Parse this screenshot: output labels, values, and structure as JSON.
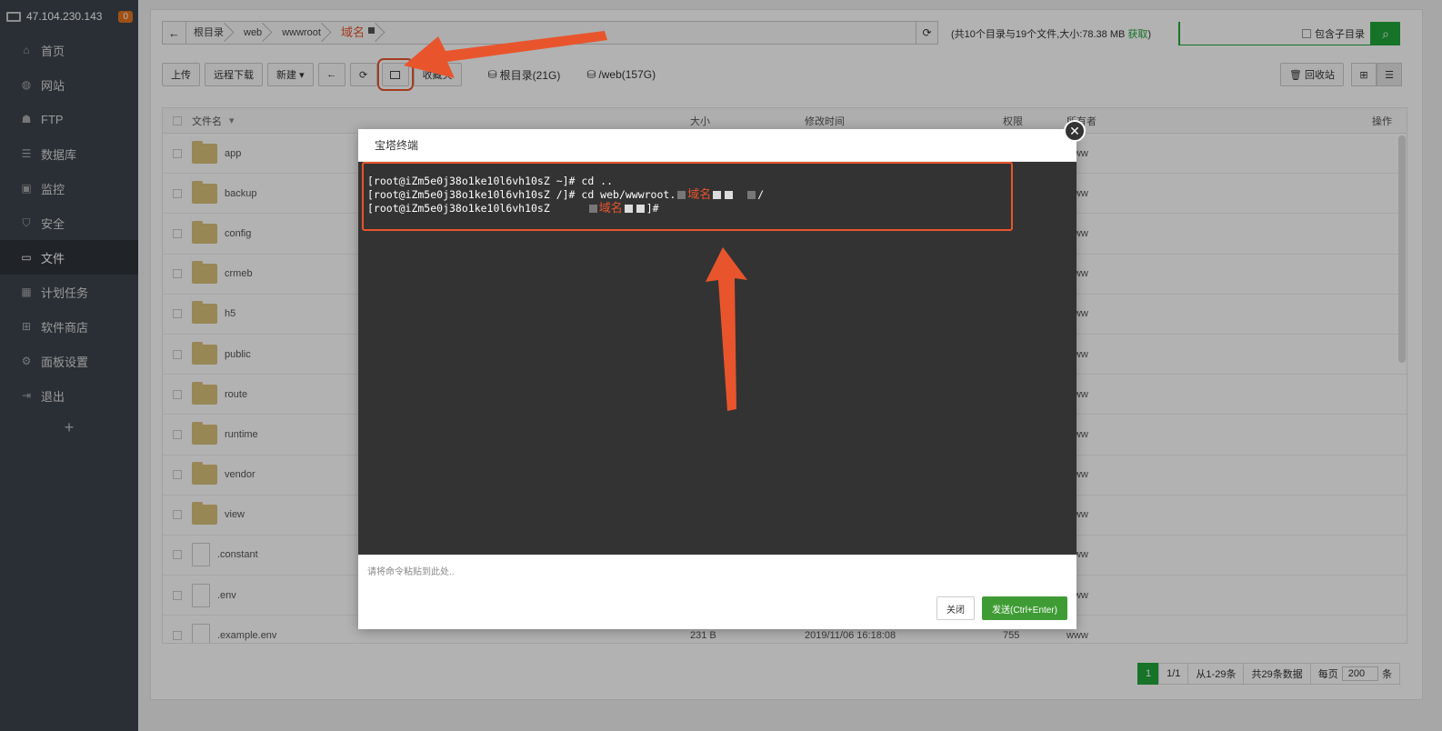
{
  "sidebar": {
    "ip": "47.104.230.143",
    "badge": "0",
    "items": [
      {
        "label": "首页",
        "icon": "home-icon"
      },
      {
        "label": "网站",
        "icon": "globe-icon"
      },
      {
        "label": "FTP",
        "icon": "ftp-icon"
      },
      {
        "label": "数据库",
        "icon": "database-icon"
      },
      {
        "label": "监控",
        "icon": "monitor-icon"
      },
      {
        "label": "安全",
        "icon": "shield-icon"
      },
      {
        "label": "文件",
        "icon": "folder-icon"
      },
      {
        "label": "计划任务",
        "icon": "calendar-icon"
      },
      {
        "label": "软件商店",
        "icon": "grid-icon"
      },
      {
        "label": "面板设置",
        "icon": "gear-icon"
      },
      {
        "label": "退出",
        "icon": "logout-icon"
      }
    ],
    "add": "+"
  },
  "path": {
    "crumbs": [
      "根目录",
      "web",
      "wwwroot",
      "域名"
    ]
  },
  "summary": {
    "text": "(共10个目录与19个文件,大小:78.38 MB",
    "link": "获取",
    "close": ")"
  },
  "search": {
    "include_sub": "包含子目录"
  },
  "toolbar": {
    "upload": "上传",
    "remote_download": "远程下载",
    "new": "新建",
    "favorites": "收藏夹",
    "disk_root": "根目录(21G)",
    "disk_web": "/web(157G)",
    "recycle": "回收站"
  },
  "table": {
    "headers": {
      "name": "文件名",
      "size": "大小",
      "mtime": "修改时间",
      "perm": "权限",
      "owner": "所有者",
      "ops": "操作"
    },
    "rows": [
      {
        "name": "app",
        "type": "folder",
        "size": "",
        "mtime": "",
        "perm": "",
        "owner": "www"
      },
      {
        "name": "backup",
        "type": "folder",
        "size": "",
        "mtime": "",
        "perm": "",
        "owner": "www"
      },
      {
        "name": "config",
        "type": "folder",
        "size": "",
        "mtime": "",
        "perm": "",
        "owner": "www"
      },
      {
        "name": "crmeb",
        "type": "folder",
        "size": "",
        "mtime": "",
        "perm": "",
        "owner": "www"
      },
      {
        "name": "h5",
        "type": "folder",
        "size": "",
        "mtime": "",
        "perm": "",
        "owner": "www"
      },
      {
        "name": "public",
        "type": "folder",
        "size": "",
        "mtime": "",
        "perm": "",
        "owner": "www"
      },
      {
        "name": "route",
        "type": "folder",
        "size": "",
        "mtime": "",
        "perm": "",
        "owner": "www"
      },
      {
        "name": "runtime",
        "type": "folder",
        "size": "",
        "mtime": "",
        "perm": "",
        "owner": "www"
      },
      {
        "name": "vendor",
        "type": "folder",
        "size": "",
        "mtime": "",
        "perm": "",
        "owner": "www"
      },
      {
        "name": "view",
        "type": "folder",
        "size": "",
        "mtime": "",
        "perm": "",
        "owner": "www"
      },
      {
        "name": ".constant",
        "type": "file",
        "size": "",
        "mtime": "",
        "perm": "",
        "owner": "www"
      },
      {
        "name": ".env",
        "type": "file",
        "size": "",
        "mtime": "",
        "perm": "",
        "owner": "www"
      },
      {
        "name": ".example.env",
        "type": "file",
        "size": "231 B",
        "mtime": "2019/11/06 16:18:08",
        "perm": "755",
        "owner": "www"
      }
    ]
  },
  "pager": {
    "current": "1",
    "pages": "1/1",
    "range": "从1-29条",
    "total": "共29条数据",
    "per_page_label": "每页",
    "per_page": "200",
    "unit": "条"
  },
  "modal": {
    "title": "宝塔终端",
    "lines": [
      "[root@iZm5e0j38o1ke10l6vh10sZ ~]# cd ..",
      "[root@iZm5e0j38o1ke10l6vh10sZ /]# cd web/wwwroot.",
      "[root@iZm5e0j38o1ke10l6vh10sZ "
    ],
    "line2_tail": "/",
    "line3_tail": "]#",
    "domain_label": "域名",
    "placeholder": "请将命令粘贴到此处..",
    "close_btn": "关闭",
    "send_btn": "发送(Ctrl+Enter)"
  },
  "colors": {
    "accent": "#20a53a",
    "annotation": "#e8552d",
    "terminal_bg": "#333333"
  }
}
